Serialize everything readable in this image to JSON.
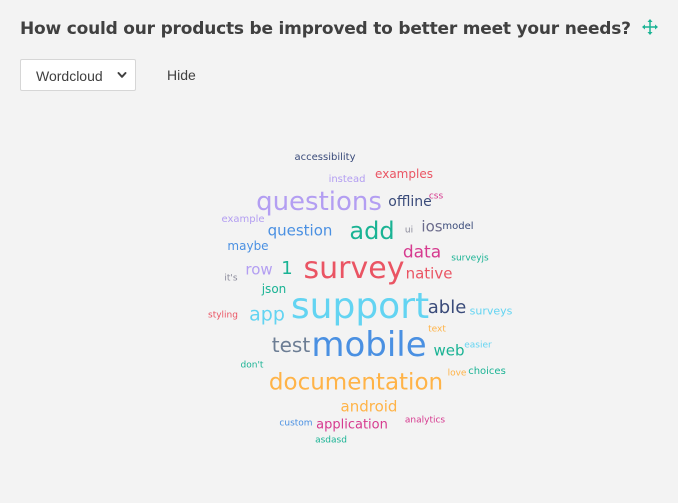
{
  "question": {
    "title": "How could our products be improved to better meet your needs?"
  },
  "toolbar": {
    "move_icon": "move-arrows-icon",
    "visualizer_selected": "Wordcloud",
    "hide_label": "Hide",
    "accent_color": "#1ab394"
  },
  "wordcloud": {
    "words": [
      {
        "text": "accessibility",
        "color": "#3a4b7a"
      },
      {
        "text": "examples",
        "color": "#ea5463"
      },
      {
        "text": "instead",
        "color": "#b39ef2"
      },
      {
        "text": "questions",
        "color": "#b39ef2"
      },
      {
        "text": "offline",
        "color": "#3a4b7a"
      },
      {
        "text": "css",
        "color": "#d63a8f"
      },
      {
        "text": "example",
        "color": "#b39ef2"
      },
      {
        "text": "add",
        "color": "#1ab394"
      },
      {
        "text": "ios",
        "color": "#6c6c8c"
      },
      {
        "text": "model",
        "color": "#3a4b7a"
      },
      {
        "text": "question",
        "color": "#4a90e2"
      },
      {
        "text": "ui",
        "color": "#8a8a9a"
      },
      {
        "text": "maybe",
        "color": "#4a90e2"
      },
      {
        "text": "data",
        "color": "#d63a8f"
      },
      {
        "text": "surveyjs",
        "color": "#1ab394"
      },
      {
        "text": "row",
        "color": "#b39ef2"
      },
      {
        "text": "1",
        "color": "#1ab394"
      },
      {
        "text": "survey",
        "color": "#ea5463"
      },
      {
        "text": "native",
        "color": "#ea5463"
      },
      {
        "text": "it's",
        "color": "#8a8a9a"
      },
      {
        "text": "json",
        "color": "#1ab394"
      },
      {
        "text": "styling",
        "color": "#ea5463"
      },
      {
        "text": "app",
        "color": "#63d4f2"
      },
      {
        "text": "support",
        "color": "#63d4f2"
      },
      {
        "text": "able",
        "color": "#3a4b7a"
      },
      {
        "text": "surveys",
        "color": "#63d4f2"
      },
      {
        "text": "text",
        "color": "#ffb347"
      },
      {
        "text": "test",
        "color": "#6c7d94"
      },
      {
        "text": "mobile",
        "color": "#4a90e2"
      },
      {
        "text": "web",
        "color": "#1ab394"
      },
      {
        "text": "easier",
        "color": "#63d4f2"
      },
      {
        "text": "don't",
        "color": "#1ab394"
      },
      {
        "text": "love",
        "color": "#ffb347"
      },
      {
        "text": "choices",
        "color": "#1ab394"
      },
      {
        "text": "documentation",
        "color": "#ffb347"
      },
      {
        "text": "android",
        "color": "#ffb347"
      },
      {
        "text": "analytics",
        "color": "#d63a8f"
      },
      {
        "text": "custom",
        "color": "#4a90e2"
      },
      {
        "text": "application",
        "color": "#d63a8f"
      },
      {
        "text": "asdasd",
        "color": "#1ab394"
      }
    ]
  }
}
